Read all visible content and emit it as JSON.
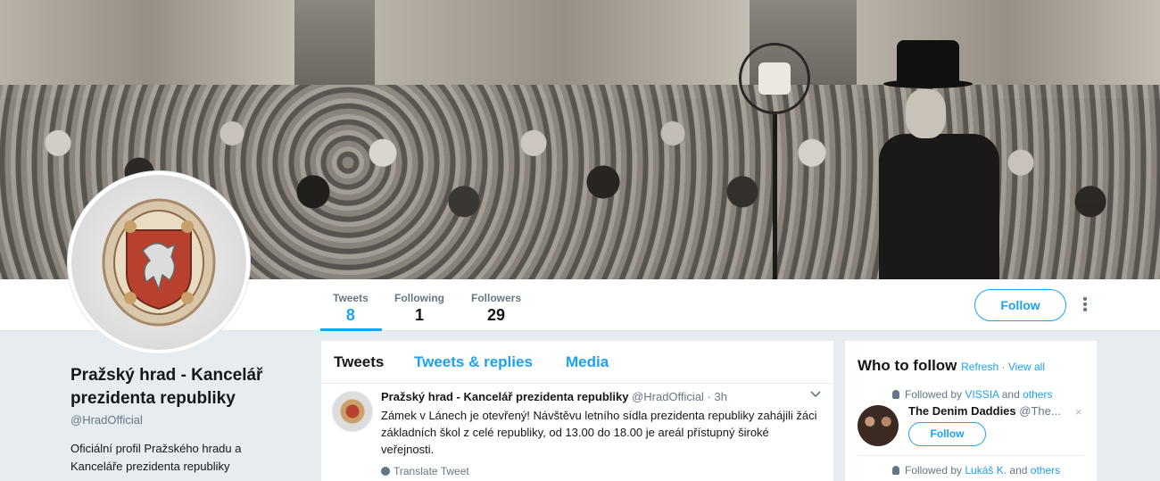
{
  "banner": {
    "alt": ""
  },
  "profile": {
    "name": "Pražský hrad - Kancelář prezidenta republiky",
    "handle": "@HradOfficial",
    "bio": "Oficiální profil Pražského hradu a Kanceláře prezidenta republiky"
  },
  "nav": {
    "stats": [
      {
        "label": "Tweets",
        "value": "8"
      },
      {
        "label": "Following",
        "value": "1"
      },
      {
        "label": "Followers",
        "value": "29"
      }
    ],
    "follow_label": "Follow",
    "more_icon": "vertical-dots-icon"
  },
  "timeline": {
    "tabs": [
      "Tweets",
      "Tweets & replies",
      "Media"
    ],
    "tweet": {
      "name": "Pražský hrad - Kancelář prezidenta republiky",
      "handle": "@HradOfficial",
      "separator": "·",
      "time": "3h",
      "text": "Zámek v Lánech je otevřený! Návštěvu letního sídla prezidenta republiky zahájili žáci základních škol z celé republiky, od 13.00 do 18.00 je areál přístupný široké veřejnosti.",
      "translate": "Translate Tweet"
    }
  },
  "who_to_follow": {
    "title": "Who to follow",
    "refresh": "Refresh",
    "dot": "·",
    "view_all": "View all",
    "suggestions": [
      {
        "followed_by_prefix": "Followed by",
        "followed_by_user": "VISSIA",
        "and": "and",
        "others": "others",
        "name": "The Denim Daddies",
        "handle": "@The...",
        "follow_label": "Follow",
        "close": "×"
      },
      {
        "followed_by_prefix": "Followed by",
        "followed_by_user": "Lukáš K.",
        "and": "and",
        "others": "others"
      }
    ]
  },
  "colors": {
    "accent": "#1da1f2",
    "muted": "#657786",
    "background": "#e6ecf0"
  }
}
